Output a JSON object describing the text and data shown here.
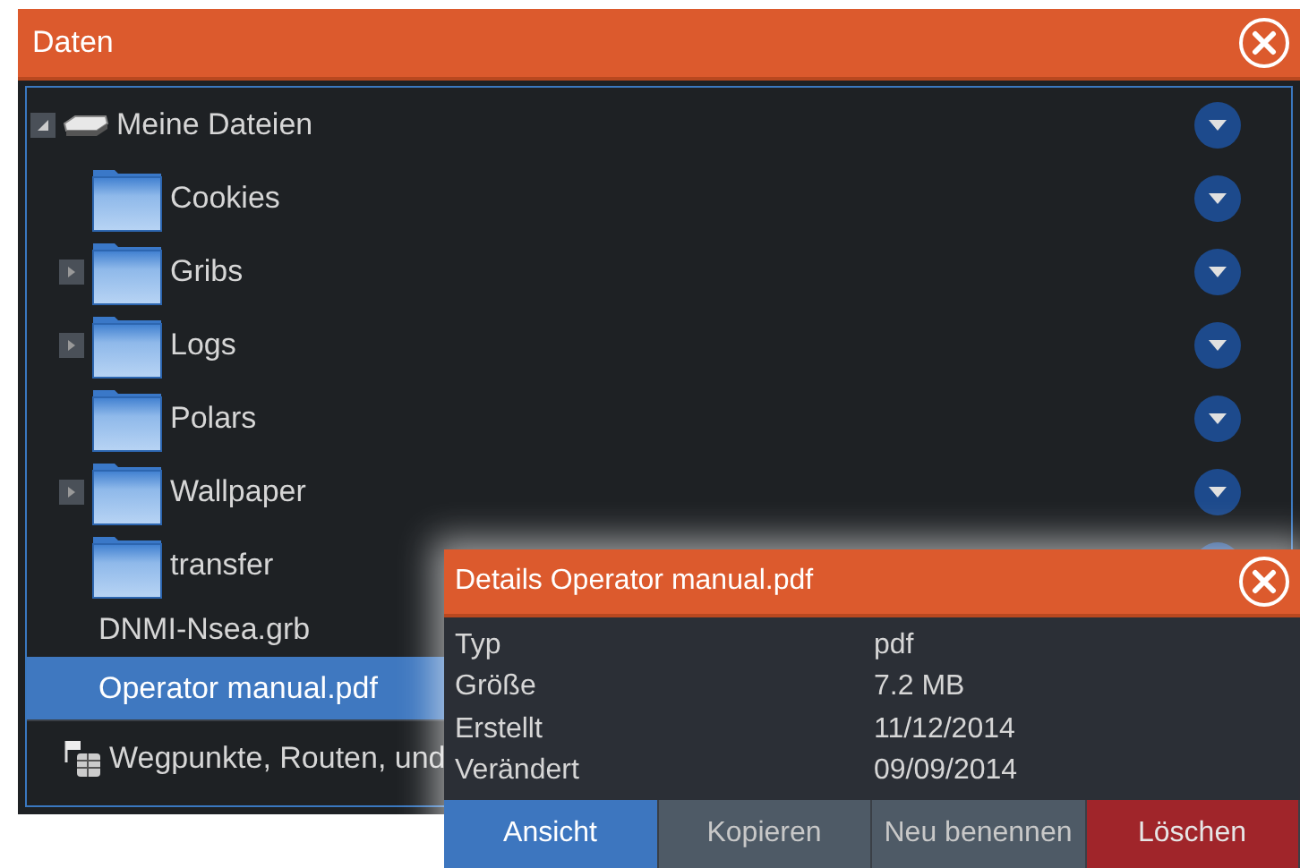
{
  "window": {
    "title": "Daten"
  },
  "tree": [
    {
      "label": "Meine Dateien",
      "kind": "drive",
      "expanded": true,
      "selected": false,
      "children": [
        {
          "label": "Cookies",
          "kind": "folder",
          "selected": false
        },
        {
          "label": "Gribs",
          "kind": "folder",
          "expanded": false,
          "selected": false
        },
        {
          "label": "Logs",
          "kind": "folder",
          "expanded": false,
          "selected": false
        },
        {
          "label": "Polars",
          "kind": "folder",
          "selected": false
        },
        {
          "label": "Wallpaper",
          "kind": "folder",
          "expanded": false,
          "selected": false
        },
        {
          "label": "transfer",
          "kind": "folder",
          "selected": false
        },
        {
          "label": "DNMI-Nsea.grb",
          "kind": "file",
          "selected": false
        },
        {
          "label": "Operator manual.pdf",
          "kind": "file",
          "selected": true
        }
      ]
    },
    {
      "label": "Wegpunkte, Routen, und",
      "kind": "database",
      "selected": false
    }
  ],
  "details": {
    "title": "Details Operator manual.pdf",
    "rows": [
      {
        "label": "Typ",
        "value": "pdf"
      },
      {
        "label": "Größe",
        "value": "7.2 MB"
      },
      {
        "label": "Erstellt",
        "value": "11/12/2014"
      },
      {
        "label": "Verändert",
        "value": "09/09/2014"
      }
    ],
    "buttons": [
      {
        "label": "Ansicht",
        "kind": "primary"
      },
      {
        "label": "Kopieren",
        "kind": "secondary"
      },
      {
        "label": "Neu benennen",
        "kind": "secondary"
      },
      {
        "label": "Löschen",
        "kind": "danger"
      }
    ]
  }
}
